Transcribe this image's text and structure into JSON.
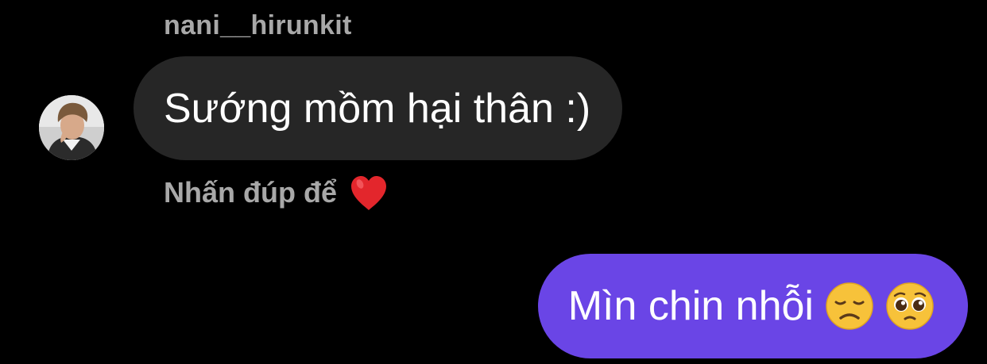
{
  "conversation": {
    "incoming": {
      "sender_name": "nani__hirunkit",
      "message": "Sướng mồm hại thân :)",
      "double_tap_hint": "Nhấn đúp để",
      "hint_icon": "red-heart-icon"
    },
    "outgoing": {
      "message": "Mìn chin nhỗi",
      "emojis": [
        "disappointed-face-icon",
        "pleading-face-icon"
      ]
    }
  },
  "colors": {
    "background": "#000000",
    "incoming_bubble": "#262626",
    "outgoing_bubble": "#6a45e6",
    "secondary_text": "#a8a8a8",
    "primary_text": "#ffffff"
  }
}
